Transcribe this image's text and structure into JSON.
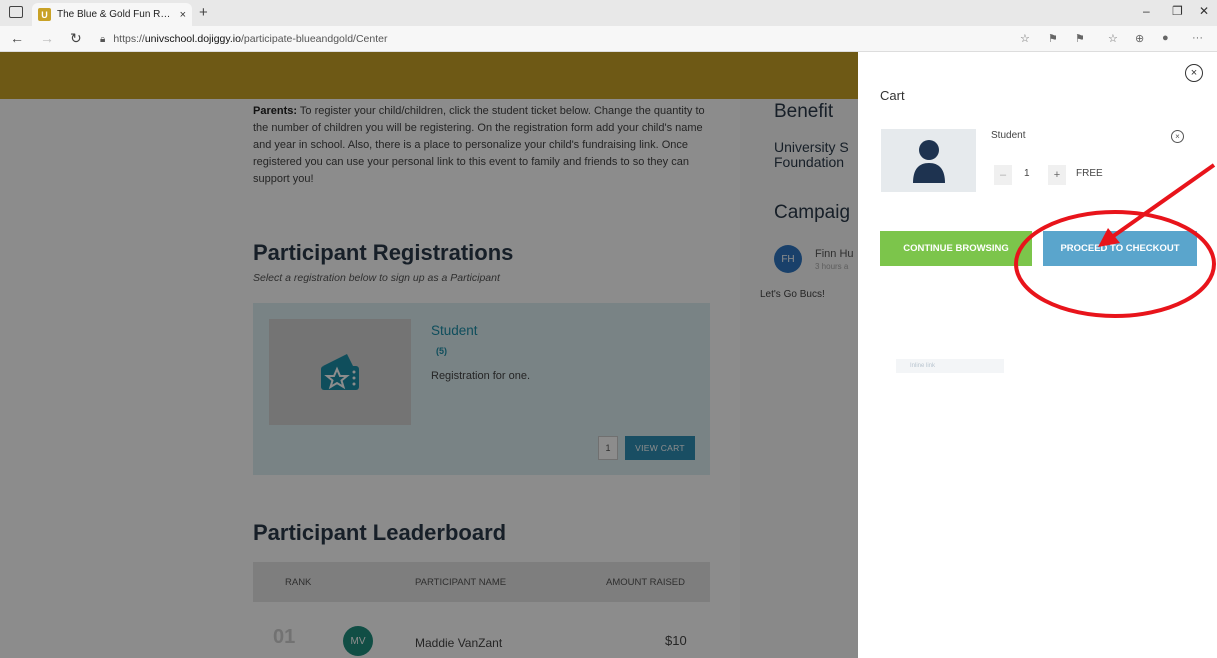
{
  "browser": {
    "tab_title": "The Blue & Gold Fun Run | Dojig",
    "tab_close": "×",
    "new_tab": "+",
    "url_prefix": "https://",
    "url_host": "univschool.dojiggy.io",
    "url_path": "/participate-blueandgold/Center"
  },
  "page": {
    "parents_label": "Parents:",
    "parents_text": " To register your child/children, click the student ticket below.  Change the quantity to the number of children you will be registering.  On the registration form add your child's name and year in school. Also, there is a place to personalize your child's fundraising link. Once registered you can use your personal link to this event to family and friends to so they can support you!",
    "registrations_title": "Participant Registrations",
    "registrations_subtitle": "Select a registration below to sign up as a Participant",
    "ticket": {
      "title": "Student",
      "count": "(5)",
      "description": "Registration for one.",
      "qty": "1",
      "view_cart": "VIEW CART"
    },
    "leaderboard_title": "Participant Leaderboard",
    "leaderboard": {
      "headers": {
        "rank": "RANK",
        "name": "PARTICIPANT NAME",
        "amount": "AMOUNT RAISED"
      },
      "rows": [
        {
          "rank": "01",
          "initials": "MV",
          "name": "Maddie VanZant",
          "amount": "$10"
        }
      ]
    },
    "sidebar": {
      "benefit": "Benefit",
      "org_line1": "University S",
      "org_line2": "Foundation",
      "campaign": "Campaig",
      "donor_initials": "FH",
      "donor_name": "Finn Hu",
      "donor_time": "3 hours a",
      "donor_message": "Let's Go Bucs!"
    }
  },
  "cart": {
    "title": "Cart",
    "close": "×",
    "item": {
      "name": "Student",
      "remove": "×",
      "minus": "–",
      "qty": "1",
      "plus": "+",
      "price": "FREE"
    },
    "continue_label": "CONTINUE BROWSING",
    "checkout_label": "PROCEED TO CHECKOUT",
    "faint_text": "Inline link"
  },
  "colors": {
    "gold": "#c9a227",
    "teal": "#1c8fa8",
    "continue_green": "#7cc54b",
    "checkout_blue": "#5aa5cc",
    "annotation_red": "#e8141b"
  }
}
